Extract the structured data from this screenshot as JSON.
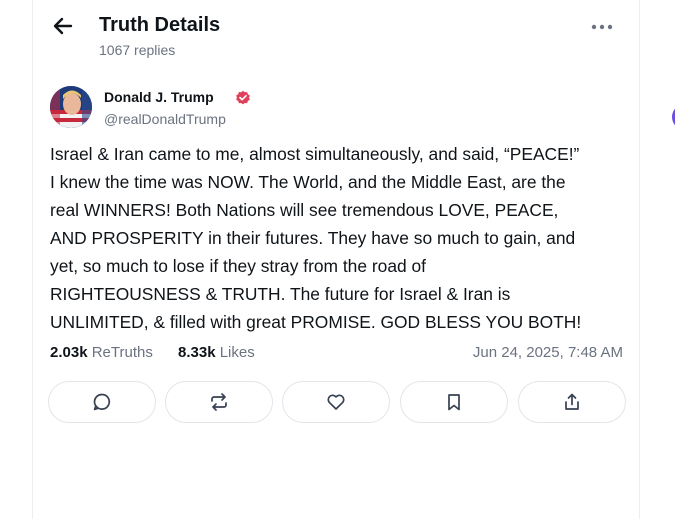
{
  "header": {
    "title": "Truth Details",
    "replies": "1067 replies"
  },
  "post": {
    "author_name": "Donald J. Trump",
    "author_handle": "@realDonaldTrump",
    "lines": [
      "Israel & Iran came to me, almost simultaneously, and said, “PEACE!”",
      "I knew the time was NOW. The World, and the Middle East, are the",
      "real WINNERS! Both Nations will see tremendous LOVE, PEACE,",
      "AND PROSPERITY in their futures. They have so much to gain, and",
      "yet, so much to lose if they stray from the road of",
      "RIGHTEOUSNESS & TRUTH. The future for Israel & Iran is",
      "UNLIMITED, & filled with great PROMISE. GOD BLESS YOU BOTH!"
    ],
    "retruths_count": "2.03k",
    "retruths_label": "ReTruths",
    "likes_count": "8.33k",
    "likes_label": "Likes",
    "timestamp": "Jun 24, 2025, 7:48 AM"
  },
  "actions": [
    "reply-icon",
    "retruth-icon",
    "like-icon",
    "bookmark-icon",
    "share-icon"
  ],
  "colors": {
    "verified": "#e0415a",
    "muted_text": "#6b7280",
    "border": "#e3e5ea",
    "accent_purple": "#6d4ce0"
  }
}
